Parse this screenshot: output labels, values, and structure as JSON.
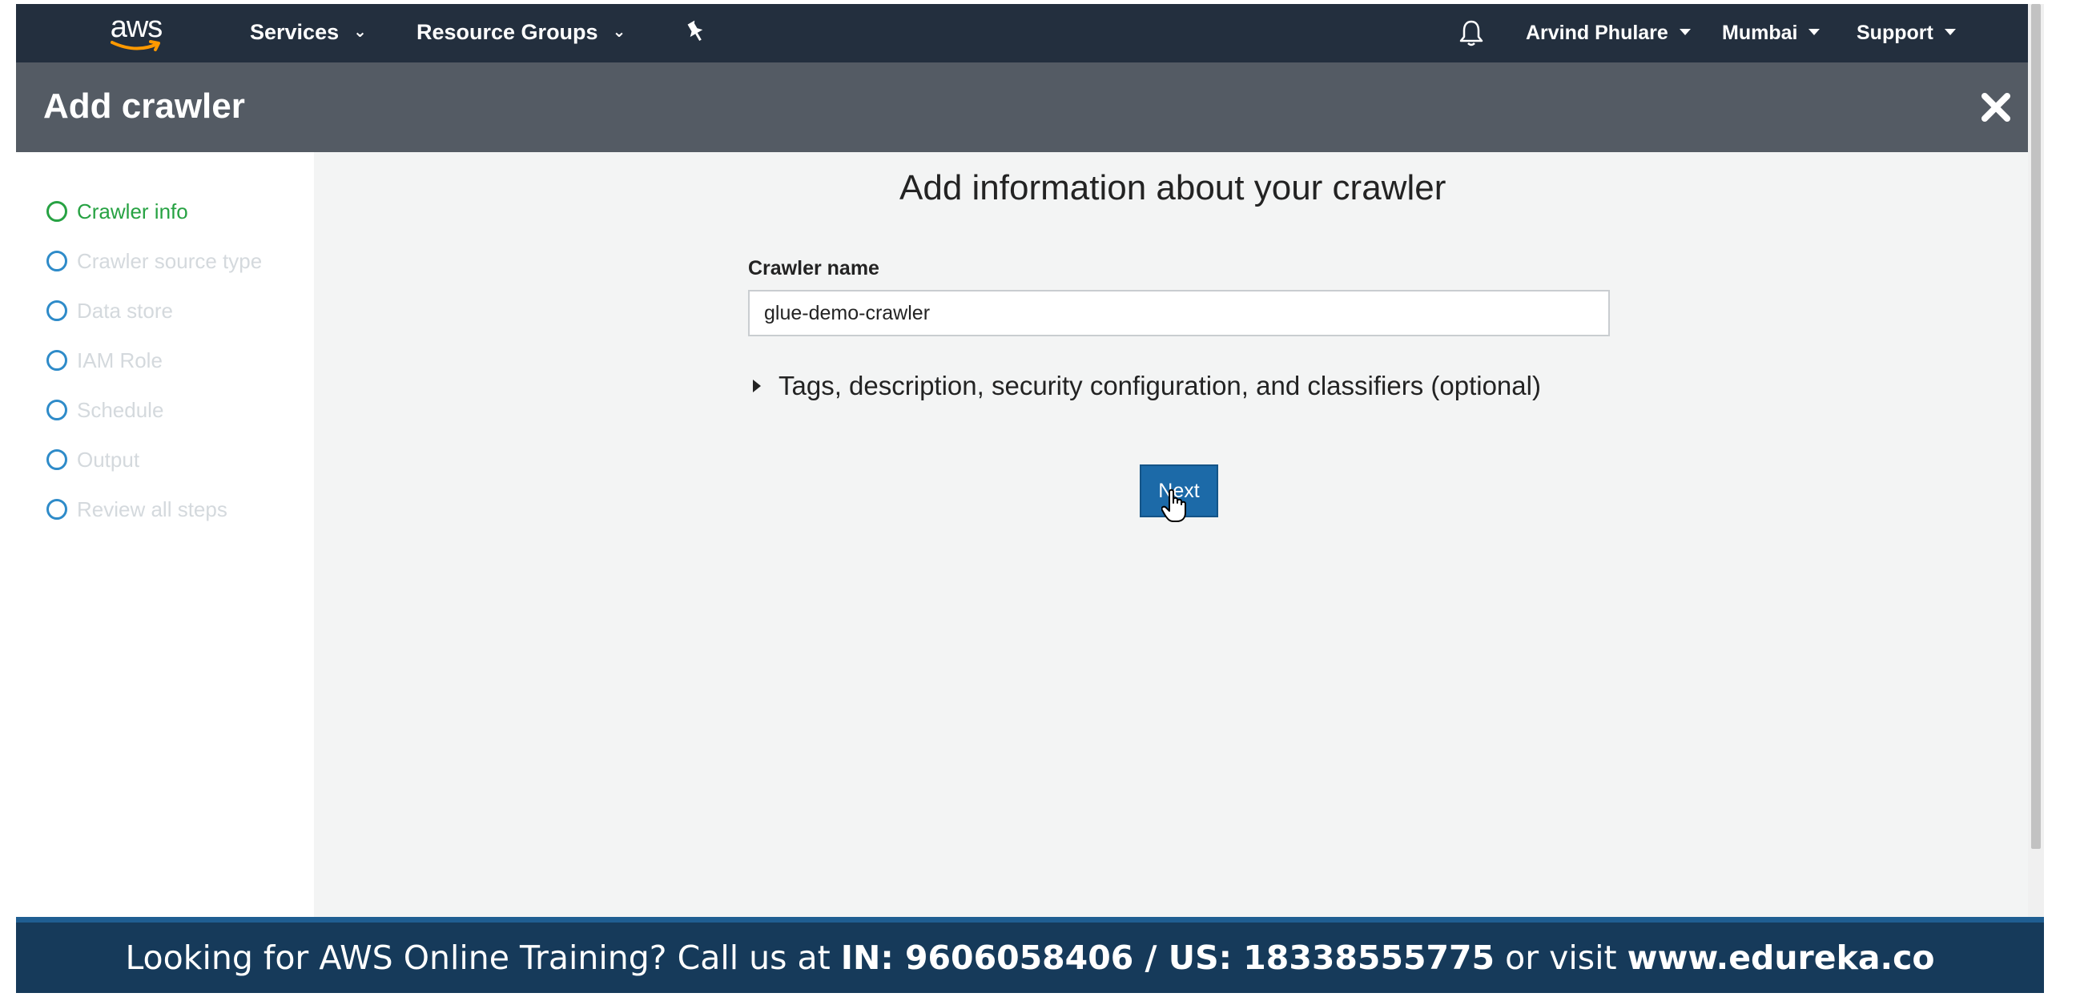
{
  "nav": {
    "logo_text": "aws",
    "services": "Services",
    "resource_groups": "Resource Groups",
    "user": "Arvind Phulare",
    "region": "Mumbai",
    "support": "Support"
  },
  "header": {
    "title": "Add crawler"
  },
  "steps": [
    {
      "label": "Crawler info",
      "active": true
    },
    {
      "label": "Crawler source type",
      "active": false
    },
    {
      "label": "Data store",
      "active": false
    },
    {
      "label": "IAM Role",
      "active": false
    },
    {
      "label": "Schedule",
      "active": false
    },
    {
      "label": "Output",
      "active": false
    },
    {
      "label": "Review all steps",
      "active": false
    }
  ],
  "main": {
    "title": "Add information about your crawler",
    "crawler_name_label": "Crawler name",
    "crawler_name_value": "glue-demo-crawler",
    "optional_section": "Tags, description, security configuration, and classifiers (optional)",
    "next_label": "Next"
  },
  "banner": {
    "prefix": "Looking for AWS Online Training? Call us at ",
    "phones": "IN: 9606058406 / US: 18338555775",
    "middle": " or visit ",
    "site": "www.edureka.co"
  },
  "colors": {
    "nav_bg": "#232f3e",
    "header_bg": "#545b64",
    "active_step": "#27a243",
    "inactive_step_circle": "#2e8bc9",
    "primary_button": "#1c6aa8",
    "banner_bg": "#163a5a"
  }
}
